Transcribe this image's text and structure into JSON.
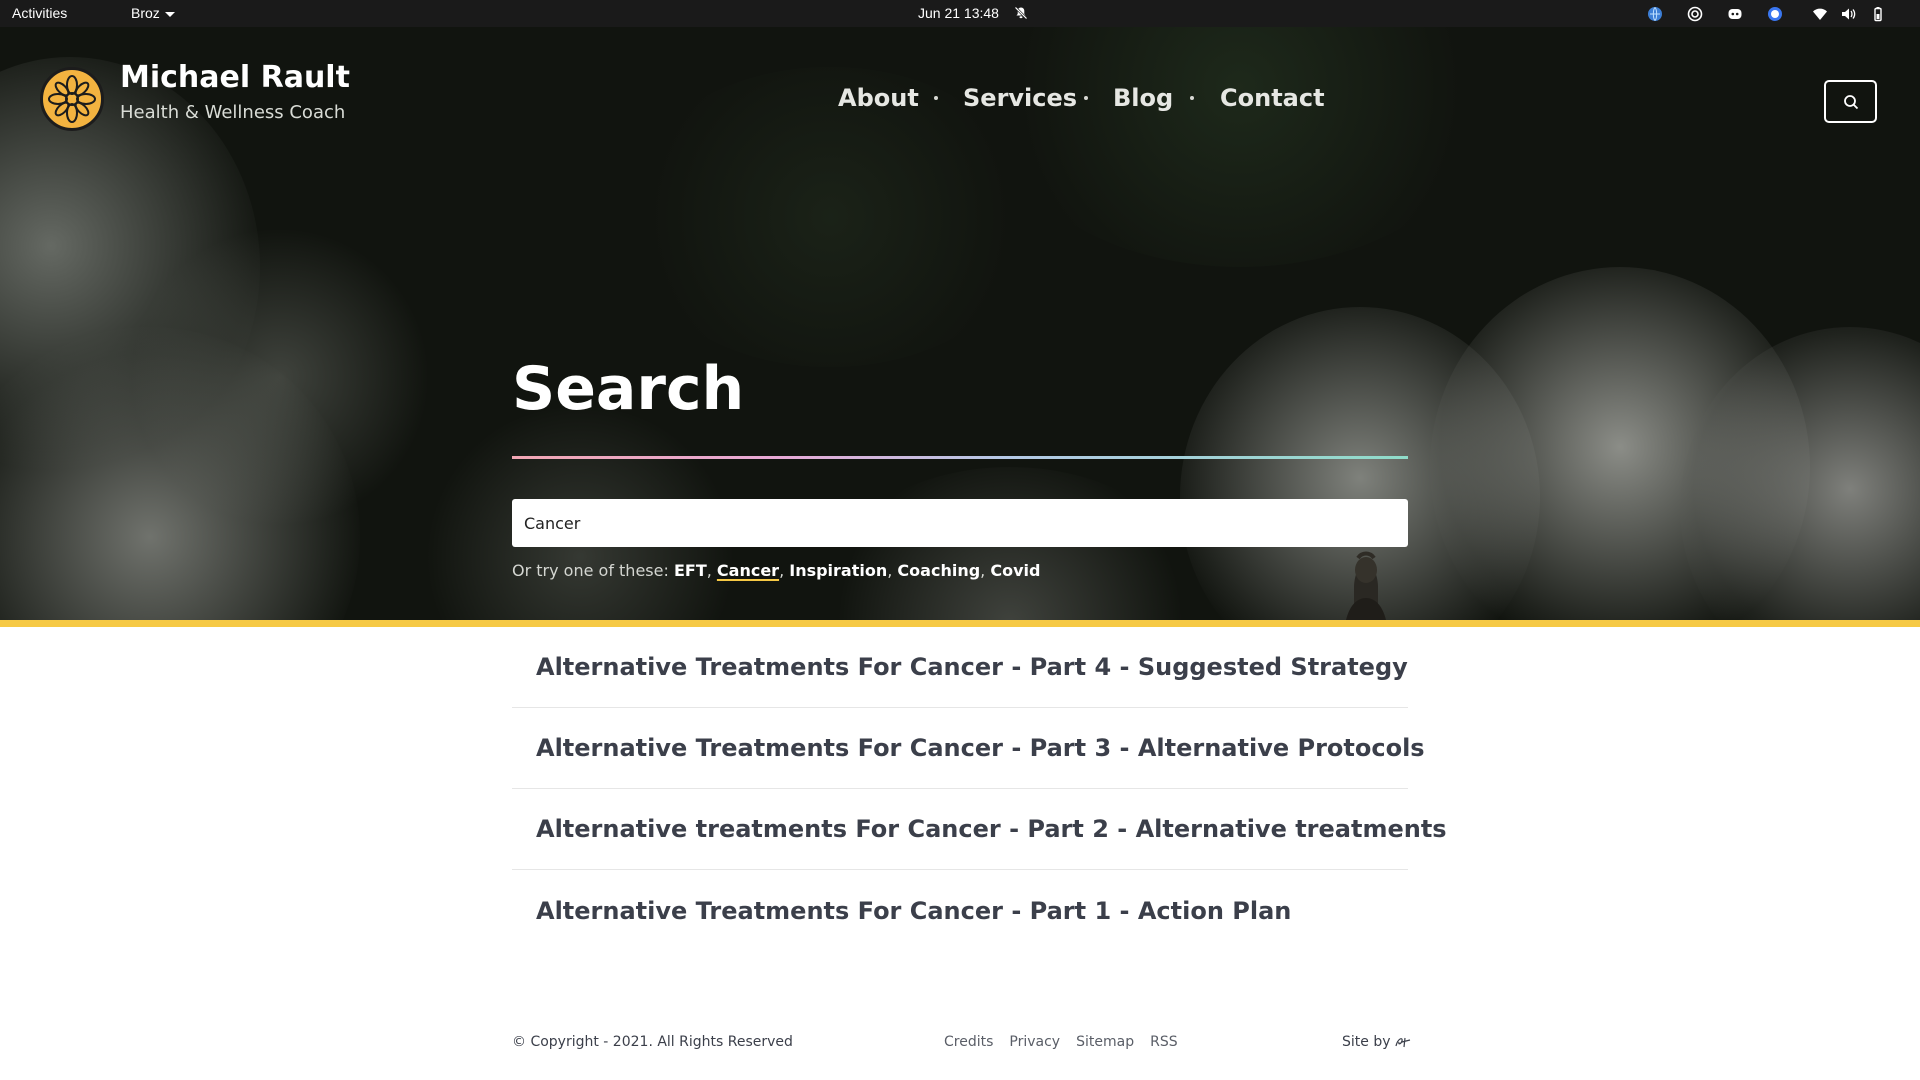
{
  "system_bar": {
    "activities": "Activities",
    "app_menu": "Broz",
    "clock": "Jun 21  13:48",
    "tray_icons": [
      "globe-icon",
      "target-icon",
      "discord-icon",
      "signal-icon",
      "wifi-icon",
      "volume-icon",
      "battery-icon"
    ]
  },
  "header": {
    "title": "Michael Rault",
    "tagline": "Health & Wellness Coach",
    "logo_icon": "mandala-logo-icon",
    "nav": [
      "About",
      "Services",
      "Blog",
      "Contact"
    ],
    "search_icon": "search-icon"
  },
  "search": {
    "heading": "Search",
    "value": "Cancer",
    "suggest_prefix": "Or try one of these: ",
    "suggestions": [
      "EFT",
      "Cancer",
      "Inspiration",
      "Coaching",
      "Covid"
    ],
    "active_suggestion": "Cancer"
  },
  "results": [
    "Alternative Treatments For Cancer - Part 4 - Suggested Strategy",
    "Alternative Treatments For Cancer - Part 3 - Alternative Protocols",
    "Alternative treatments For Cancer - Part 2 - Alternative treatments",
    "Alternative Treatments For Cancer - Part 1 - Action Plan"
  ],
  "footer": {
    "copyright": "© Copyright - 2021. All Rights Reserved",
    "links": [
      "Credits",
      "Privacy",
      "Sitemap",
      "RSS"
    ],
    "site_by": "Site by"
  },
  "colors": {
    "accent_yellow": "#f6c945",
    "logo_orange": "#f3b340",
    "text_dark": "#3b3f4a",
    "hero_dark": "#11140f"
  }
}
